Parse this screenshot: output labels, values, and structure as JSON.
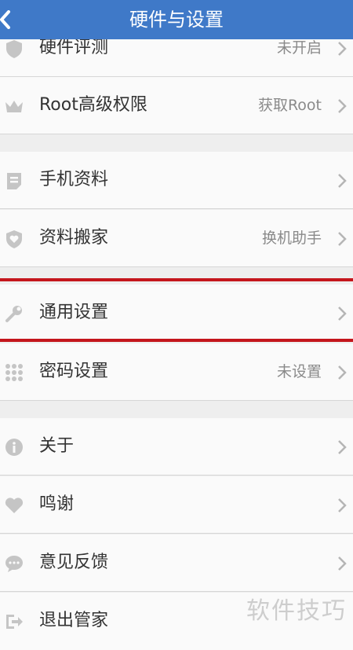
{
  "header": {
    "title": "硬件与设置"
  },
  "rows": [
    {
      "label": "硬件评测",
      "value": "未开启"
    },
    {
      "label": "Root高级权限",
      "value": "获取Root"
    },
    {
      "label": "手机资料",
      "value": ""
    },
    {
      "label": "资料搬家",
      "value": "换机助手"
    },
    {
      "label": "通用设置",
      "value": ""
    },
    {
      "label": "密码设置",
      "value": "未设置"
    },
    {
      "label": "关于",
      "value": ""
    },
    {
      "label": "鸣谢",
      "value": ""
    },
    {
      "label": "意见反馈",
      "value": ""
    },
    {
      "label": "退出管家",
      "value": ""
    }
  ],
  "icons": [
    "shield-icon",
    "crown-icon",
    "document-icon",
    "shield-heart-icon",
    "wrench-icon",
    "dial-grid-icon",
    "info-icon",
    "heart-icon",
    "chat-icon",
    "exit-icon"
  ],
  "watermark": "软件技巧",
  "colors": {
    "header": "#3f79c8",
    "highlight": "#c4161c",
    "icon": "#c5c5c5"
  }
}
